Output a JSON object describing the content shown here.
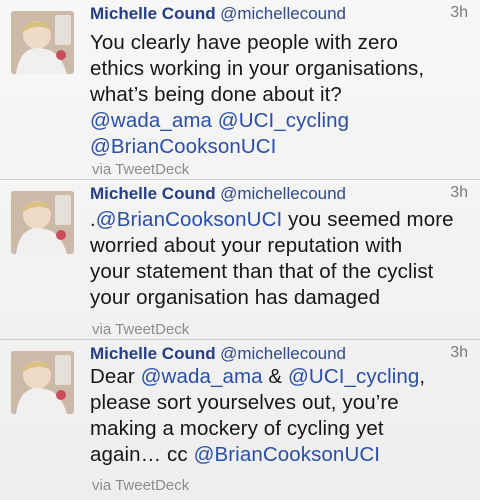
{
  "colors": {
    "name": "#243f86",
    "mention": "#2a4fa6",
    "meta": "#8c8c8c",
    "background": "#f3f3f3"
  },
  "tweets": [
    {
      "name": "Michelle Cound",
      "handle": "@michellecound",
      "time": "3h",
      "lines": [
        {
          "pre": "You clearly have people with zero",
          "mention": "",
          "post": ""
        },
        {
          "pre": "ethics working in your organisations,",
          "mention": "",
          "post": ""
        },
        {
          "pre": "what’s being done about it?",
          "mention": "",
          "post": ""
        },
        {
          "pre": "",
          "mention": "@wada_ama @UCI_cycling",
          "post": ""
        },
        {
          "pre": "",
          "mention": "@BrianCooksonUCI",
          "post": ""
        }
      ],
      "via": "via TweetDeck",
      "avatar_icon": "profile-photo"
    },
    {
      "name": "Michelle Cound",
      "handle": "@michellecound",
      "time": "3h",
      "lines": [
        {
          "pre": ".",
          "mention": "@BrianCooksonUCI",
          "post": " you seemed more"
        },
        {
          "pre": "worried about your reputation with",
          "mention": "",
          "post": ""
        },
        {
          "pre": "your statement than that of the cyclist",
          "mention": "",
          "post": ""
        },
        {
          "pre": "your organisation has damaged",
          "mention": "",
          "post": ""
        }
      ],
      "via": "via TweetDeck",
      "avatar_icon": "profile-photo"
    },
    {
      "name": "Michelle Cound",
      "handle": "@michellecound",
      "time": "3h",
      "lines": [
        {
          "pre": "Dear ",
          "mention": "@wada_ama",
          "post": " & ",
          "mention2": "@UCI_cycling",
          "post2": ","
        },
        {
          "pre": "please sort yourselves out, you’re",
          "mention": "",
          "post": ""
        },
        {
          "pre": "making a mockery of cycling yet",
          "mention": "",
          "post": ""
        },
        {
          "pre": "again… cc ",
          "mention": "@BrianCooksonUCI",
          "post": ""
        }
      ],
      "via": "via TweetDeck",
      "avatar_icon": "profile-photo"
    }
  ]
}
